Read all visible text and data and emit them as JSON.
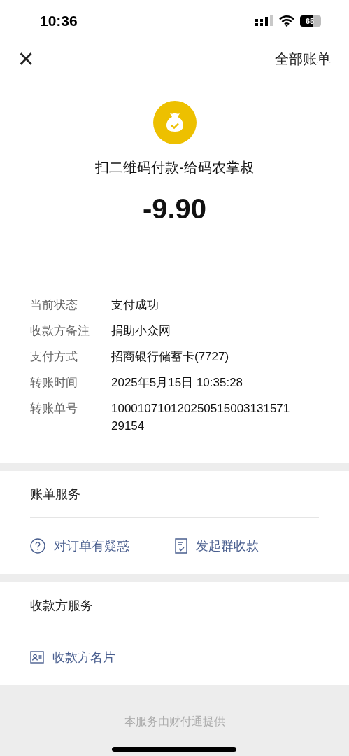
{
  "status_bar": {
    "time": "10:36",
    "battery": "65"
  },
  "header": {
    "close": "×",
    "all_bills": "全部账单"
  },
  "summary": {
    "title": "扫二维码付款-给码农掌叔",
    "amount": "-9.90"
  },
  "details": [
    {
      "label": "当前状态",
      "value": "支付成功"
    },
    {
      "label": "收款方备注",
      "value": "捐助小众网"
    },
    {
      "label": "支付方式",
      "value": "招商银行储蓄卡(7727)"
    },
    {
      "label": "转账时间",
      "value": "2025年5月15日 10:35:28"
    },
    {
      "label": "转账单号",
      "value": "100010710120250515003131571 29154"
    }
  ],
  "sections": [
    {
      "title": "账单服务",
      "actions": [
        {
          "kind": "question",
          "label": "对订单有疑惑"
        },
        {
          "kind": "document",
          "label": "发起群收款"
        }
      ]
    },
    {
      "title": "收款方服务",
      "actions": [
        {
          "kind": "card",
          "label": "收款方名片"
        }
      ]
    }
  ],
  "footer": "本服务由财付通提供"
}
